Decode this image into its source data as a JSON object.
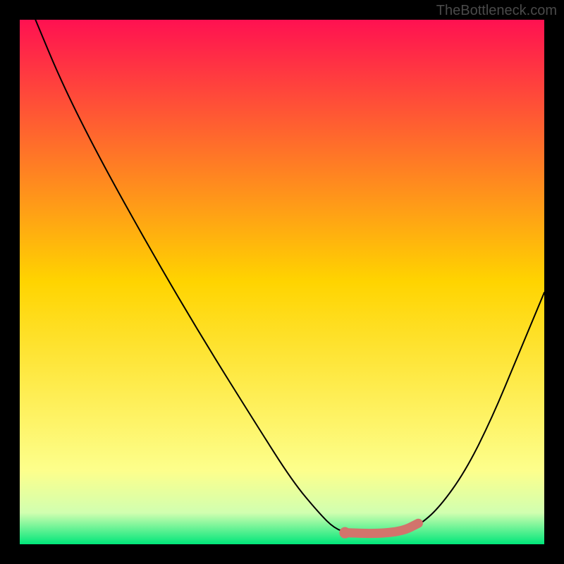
{
  "watermark": "TheBottleneck.com",
  "chart_data": {
    "type": "line",
    "title": "",
    "xlabel": "",
    "ylabel": "",
    "xlim": [
      0,
      100
    ],
    "ylim": [
      0,
      100
    ],
    "background_gradient": {
      "stops": [
        {
          "offset": 0,
          "color": "#ff1151"
        },
        {
          "offset": 0.5,
          "color": "#ffd400"
        },
        {
          "offset": 0.86,
          "color": "#fdff8c"
        },
        {
          "offset": 0.94,
          "color": "#d1ffb0"
        },
        {
          "offset": 1.0,
          "color": "#00e67a"
        }
      ]
    },
    "series": [
      {
        "name": "bottleneck-curve",
        "color": "#000000",
        "type": "line",
        "points": [
          {
            "x": 3,
            "y": 100
          },
          {
            "x": 8,
            "y": 88
          },
          {
            "x": 15,
            "y": 74
          },
          {
            "x": 25,
            "y": 56
          },
          {
            "x": 35,
            "y": 39
          },
          {
            "x": 45,
            "y": 23
          },
          {
            "x": 52,
            "y": 12
          },
          {
            "x": 57,
            "y": 6
          },
          {
            "x": 60,
            "y": 3
          },
          {
            "x": 63,
            "y": 2
          },
          {
            "x": 68,
            "y": 2
          },
          {
            "x": 73,
            "y": 2.5
          },
          {
            "x": 76,
            "y": 3.5
          },
          {
            "x": 80,
            "y": 7
          },
          {
            "x": 85,
            "y": 14
          },
          {
            "x": 90,
            "y": 24
          },
          {
            "x": 95,
            "y": 36
          },
          {
            "x": 100,
            "y": 48
          }
        ]
      },
      {
        "name": "optimal-range",
        "color": "#d2746c",
        "type": "thick-segment",
        "points": [
          {
            "x": 62,
            "y": 2.2
          },
          {
            "x": 68,
            "y": 2
          },
          {
            "x": 73,
            "y": 2.5
          },
          {
            "x": 76,
            "y": 4
          }
        ]
      }
    ],
    "markers": [
      {
        "name": "optimal-start-dot",
        "x": 62,
        "y": 2.2,
        "color": "#d2746c"
      }
    ]
  }
}
